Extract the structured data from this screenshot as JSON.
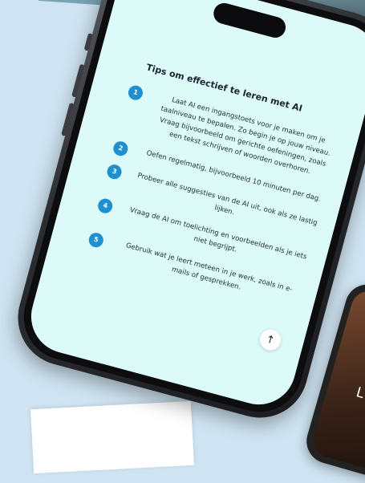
{
  "article": {
    "title": "Tips om effectief te leren met AI",
    "tips": [
      {
        "number": "1",
        "text": "Laat AI een ingangstoets voor je maken om je taalniveau te bepalen. Zo begin je op jouw niveau. Vraag bijvoorbeeld om gerichte oefeningen, zoals een tekst schrijven of woorden overhoren."
      },
      {
        "number": "2",
        "text": "Oefen regelmatig, bijvoorbeeld 10 minuten per dag."
      },
      {
        "number": "3",
        "text": "Probeer alle suggesties van de AI uit, ook als ze lastig lijken."
      },
      {
        "number": "4",
        "text": "Vraag de AI om toelichting en voorbeelden als je iets niet begrijpt."
      },
      {
        "number": "5",
        "text": "Gebruik wat je leert meteen in je werk, zoals in e-mails of gesprekken."
      }
    ]
  },
  "scroll_top_icon": "arrow-up-icon",
  "second_phone_letter": "L",
  "colors": {
    "background": "#cfe4f2",
    "screen": "#dcfbf8",
    "accent": "#1e8fd0"
  }
}
